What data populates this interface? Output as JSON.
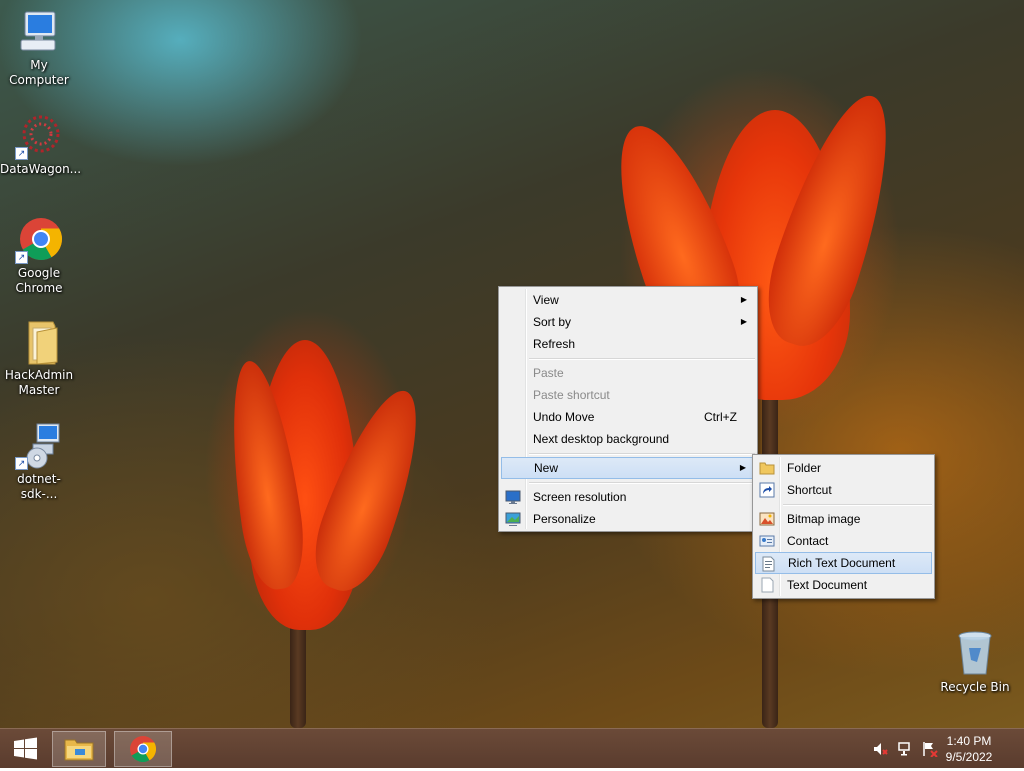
{
  "desktop_icons": [
    {
      "label": "My Computer",
      "icon": "computer-icon"
    },
    {
      "label": "DataWagon...",
      "icon": "datawagon-icon"
    },
    {
      "label": "Google Chrome",
      "icon": "chrome-icon"
    },
    {
      "label": "HackAdmin Master",
      "icon": "folder-icon"
    },
    {
      "label": "dotnet-sdk-...",
      "icon": "installer-icon"
    },
    {
      "label": "Recycle Bin",
      "icon": "recycle-bin-icon"
    }
  ],
  "context_menu": {
    "items": {
      "view": "View",
      "sort_by": "Sort by",
      "refresh": "Refresh",
      "paste": "Paste",
      "paste_shortcut": "Paste shortcut",
      "undo_move": "Undo Move",
      "undo_move_shortcut": "Ctrl+Z",
      "next_background": "Next desktop background",
      "new": "New",
      "screen_resolution": "Screen resolution",
      "personalize": "Personalize"
    }
  },
  "new_submenu": {
    "items": {
      "folder": "Folder",
      "shortcut": "Shortcut",
      "bitmap": "Bitmap image",
      "contact": "Contact",
      "rich_text": "Rich Text Document",
      "text": "Text Document"
    }
  },
  "taskbar": {
    "clock_time": "1:40 PM",
    "clock_date": "9/5/2022"
  },
  "colors": {
    "menu_bg": "#f0f0f0",
    "highlight_bg": "#cddff5",
    "highlight_border": "#94bde8",
    "taskbar_bg": "#5a3c2e"
  }
}
